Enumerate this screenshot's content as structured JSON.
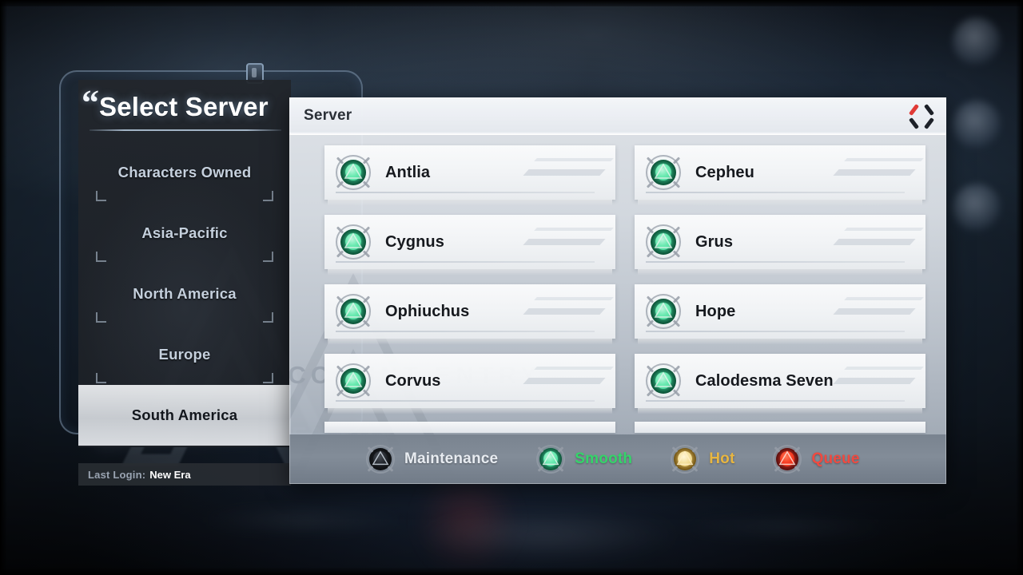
{
  "left_panel": {
    "title": "Select Server",
    "quote_mark": "“",
    "regions": [
      {
        "label": "Characters Owned",
        "selected": false
      },
      {
        "label": "Asia-Pacific",
        "selected": false
      },
      {
        "label": "North America",
        "selected": false
      },
      {
        "label": "Europe",
        "selected": false
      },
      {
        "label": "South America",
        "selected": true
      }
    ],
    "last_login_label": "Last Login:",
    "last_login_value": "New Era"
  },
  "dialog": {
    "title": "Server",
    "close_icon": "close-x-icon",
    "servers": [
      {
        "name": "Antlia",
        "status": "smooth"
      },
      {
        "name": "Cepheu",
        "status": "smooth"
      },
      {
        "name": "Cygnus",
        "status": "smooth"
      },
      {
        "name": "Grus",
        "status": "smooth"
      },
      {
        "name": "Ophiuchus",
        "status": "smooth"
      },
      {
        "name": "Hope",
        "status": "smooth"
      },
      {
        "name": "Corvus",
        "status": "smooth"
      },
      {
        "name": "Calodesma Seven",
        "status": "smooth"
      }
    ],
    "legend": [
      {
        "label": "Maintenance",
        "status": "maintenance",
        "color": "#e8ecf1"
      },
      {
        "label": "Smooth",
        "status": "smooth",
        "color": "#35d46a"
      },
      {
        "label": "Hot",
        "status": "hot",
        "color": "#e8b641"
      },
      {
        "label": "Queue",
        "status": "queue",
        "color": "#ef4a40"
      }
    ]
  },
  "background": {
    "watermark_words": [
      "ACCOUNT ENTRY"
    ]
  }
}
